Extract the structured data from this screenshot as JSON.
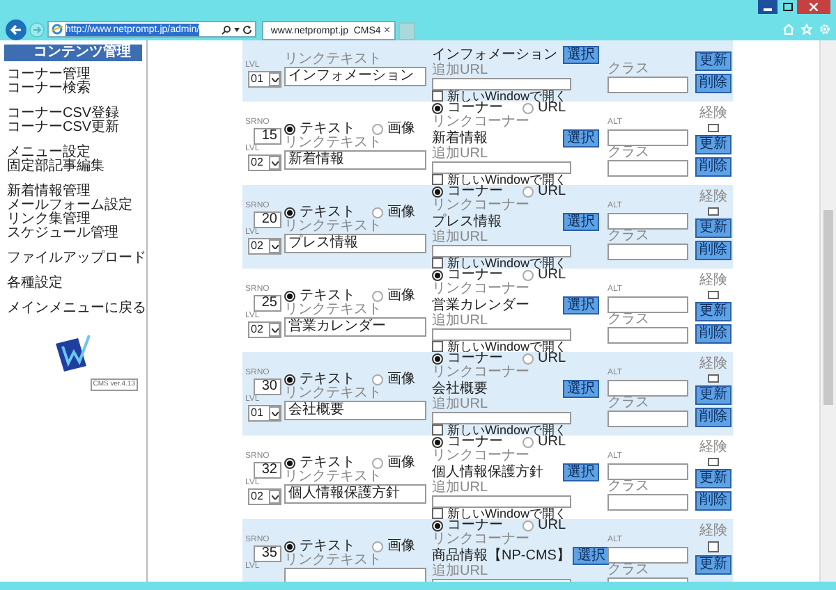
{
  "browser": {
    "url": "http://www.netprompt.jp/admin/",
    "tab_title": "www.netprompt.jp  CMS4",
    "tab_close": "×"
  },
  "sidebar": {
    "header": "コンテンツ管理",
    "groups": [
      [
        "コーナー管理",
        "コーナー検索"
      ],
      [
        "コーナーCSV登録",
        "コーナーCSV更新"
      ],
      [
        "メニュー設定",
        "固定部記事編集"
      ],
      [
        "新着情報管理",
        "メールフォーム設定",
        "リンク集管理",
        "スケジュール管理"
      ],
      [
        "ファイルアップロード"
      ],
      [
        "各種設定"
      ],
      [
        "メインメニューに戻る"
      ]
    ],
    "version": "CMS ver.4.13"
  },
  "rows": [
    {
      "kind": "clipped_top",
      "lvl_label": "LVL",
      "lvl": "01",
      "link_text_label": "リンクテキスト",
      "link_text": "インフォメーション",
      "corner_name": "インフォメーション",
      "select_button": "選択",
      "url_label": "追加URL",
      "new_window_label": "新しいWindowで開く",
      "new_window_checked": false,
      "class_label": "クラス",
      "update_button": "更新",
      "delete_button": "削除"
    },
    {
      "kind": "full",
      "srno_label": "SRNO",
      "srno": "15",
      "lvl_label": "LVL",
      "lvl": "02",
      "type_options": [
        {
          "label": "テキスト",
          "selected": true
        },
        {
          "label": "画像",
          "selected": false
        }
      ],
      "link_text_label": "リンクテキスト",
      "link_text": "新着情報",
      "target_options": [
        {
          "label": "コーナー",
          "selected": true
        },
        {
          "label": "URL",
          "selected": false
        }
      ],
      "corner_label": "リンクコーナー",
      "corner_name": "新着情報",
      "select_button": "選択",
      "url_label": "追加URL",
      "new_window_label": "新しいWindowで開く",
      "new_window_checked": false,
      "alt_label": "ALT",
      "class_label": "クラス",
      "flag_label": "経険",
      "flag_checked": false,
      "update_button": "更新",
      "delete_button": "削除"
    },
    {
      "kind": "full",
      "srno_label": "SRNO",
      "srno": "20",
      "lvl_label": "LVL",
      "lvl": "02",
      "type_options": [
        {
          "label": "テキスト",
          "selected": true
        },
        {
          "label": "画像",
          "selected": false
        }
      ],
      "link_text_label": "リンクテキスト",
      "link_text": "プレス情報",
      "target_options": [
        {
          "label": "コーナー",
          "selected": true
        },
        {
          "label": "URL",
          "selected": false
        }
      ],
      "corner_label": "リンクコーナー",
      "corner_name": "プレス情報",
      "select_button": "選択",
      "url_label": "追加URL",
      "new_window_label": "新しいWindowで開く",
      "new_window_checked": false,
      "alt_label": "ALT",
      "class_label": "クラス",
      "flag_label": "経険",
      "flag_checked": false,
      "update_button": "更新",
      "delete_button": "削除"
    },
    {
      "kind": "full",
      "srno_label": "SRNO",
      "srno": "25",
      "lvl_label": "LVL",
      "lvl": "02",
      "type_options": [
        {
          "label": "テキスト",
          "selected": true
        },
        {
          "label": "画像",
          "selected": false
        }
      ],
      "link_text_label": "リンクテキスト",
      "link_text": "営業カレンダー",
      "target_options": [
        {
          "label": "コーナー",
          "selected": true
        },
        {
          "label": "URL",
          "selected": false
        }
      ],
      "corner_label": "リンクコーナー",
      "corner_name": "営業カレンダー",
      "select_button": "選択",
      "url_label": "追加URL",
      "new_window_label": "新しいWindowで開く",
      "new_window_checked": false,
      "alt_label": "ALT",
      "class_label": "クラス",
      "flag_label": "経険",
      "flag_checked": false,
      "update_button": "更新",
      "delete_button": "削除"
    },
    {
      "kind": "full",
      "srno_label": "SRNO",
      "srno": "30",
      "lvl_label": "LVL",
      "lvl": "01",
      "type_options": [
        {
          "label": "テキスト",
          "selected": true
        },
        {
          "label": "画像",
          "selected": false
        }
      ],
      "link_text_label": "リンクテキスト",
      "link_text": "会社概要",
      "target_options": [
        {
          "label": "コーナー",
          "selected": true
        },
        {
          "label": "URL",
          "selected": false
        }
      ],
      "corner_label": "リンクコーナー",
      "corner_name": "会社概要",
      "select_button": "選択",
      "url_label": "追加URL",
      "new_window_label": "新しいWindowで開く",
      "new_window_checked": false,
      "alt_label": "ALT",
      "class_label": "クラス",
      "flag_label": "経険",
      "flag_checked": false,
      "update_button": "更新",
      "delete_button": "削除"
    },
    {
      "kind": "full",
      "srno_label": "SRNO",
      "srno": "32",
      "lvl_label": "LVL",
      "lvl": "02",
      "type_options": [
        {
          "label": "テキスト",
          "selected": true
        },
        {
          "label": "画像",
          "selected": false
        }
      ],
      "link_text_label": "リンクテキスト",
      "link_text": "個人情報保護方針",
      "target_options": [
        {
          "label": "コーナー",
          "selected": true
        },
        {
          "label": "URL",
          "selected": false
        }
      ],
      "corner_label": "リンクコーナー",
      "corner_name": "個人情報保護方針",
      "select_button": "選択",
      "url_label": "追加URL",
      "new_window_label": "新しいWindowで開く",
      "new_window_checked": false,
      "alt_label": "ALT",
      "class_label": "クラス",
      "flag_label": "経険",
      "flag_checked": false,
      "update_button": "更新",
      "delete_button": "削除"
    },
    {
      "kind": "clipped_bottom",
      "srno_label": "SRNO",
      "srno": "35",
      "lvl_label": "LVL",
      "type_options": [
        {
          "label": "テキスト",
          "selected": true
        },
        {
          "label": "画像",
          "selected": false
        }
      ],
      "link_text_label": "リンクテキスト",
      "target_options": [
        {
          "label": "コーナー",
          "selected": true
        },
        {
          "label": "URL",
          "selected": false
        }
      ],
      "corner_label": "リンクコーナー",
      "corner_name": "商品情報【NP-CMS】",
      "select_button": "選択",
      "url_label": "追加URL",
      "alt_label": "ALT",
      "class_label": "クラス",
      "flag_label": "経険",
      "flag_checked": false,
      "update_button": "更新"
    }
  ]
}
